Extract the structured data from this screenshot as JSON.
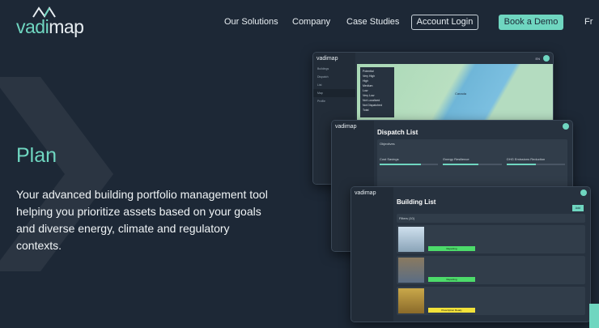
{
  "brand": {
    "name_a": "vadi",
    "name_b": "map"
  },
  "nav": {
    "items": [
      "Our Solutions",
      "Company",
      "Case Studies"
    ],
    "login": "Account Login",
    "demo": "Book a Demo",
    "lang": "Fr"
  },
  "hero": {
    "title": "Plan",
    "description": "Your advanced building portfolio management tool helping you prioritize assets based on your goals and diverse energy, climate and regulatory contexts."
  },
  "map_window": {
    "logo": "vadimap",
    "sidebar": [
      "Buildings",
      "Dispatch",
      "List",
      "Map",
      "Profile"
    ],
    "lang": "EN",
    "legend_title": "Potential",
    "legend": [
      "Very High",
      "High",
      "Medium",
      "Low",
      "Very Low",
      "Not Localized",
      "Not Dispatched",
      "Total"
    ],
    "label": "Canada"
  },
  "dispatch_window": {
    "logo": "vadimap",
    "title": "Dispatch List",
    "section": "Objectives",
    "objectives": [
      "Cost Savings",
      "Energy Resilience",
      "GHG Emissions Reduction"
    ],
    "progress": [
      0.7,
      0.6,
      0.5
    ]
  },
  "building_window": {
    "logo": "vadimap",
    "title": "Building List",
    "filters": "Filters (10)",
    "add": "Add",
    "statuses": [
      "Reporting",
      "Reporting",
      "Prescription Ready"
    ],
    "colors": {
      "reporting": "#4cdb6a",
      "prescription": "#f2e23a"
    }
  },
  "colors": {
    "accent": "#6fd6c0",
    "background": "#1d2836"
  }
}
